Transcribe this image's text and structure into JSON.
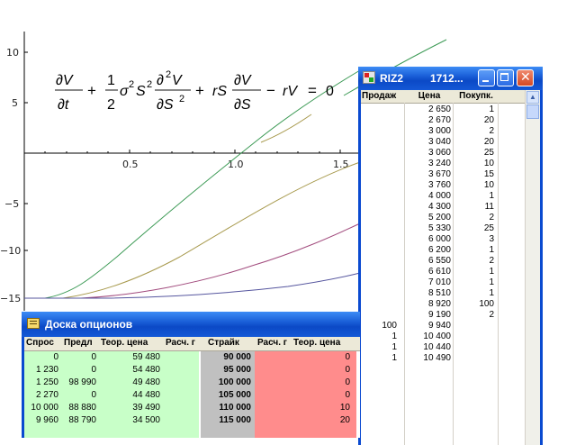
{
  "plot": {
    "equation": "∂V/∂t + ½σ²S² ∂²V/∂S² + rS ∂V/∂S − rV = 0",
    "x_ticks": [
      "0.5",
      "1.0",
      "1.5"
    ],
    "y_ticks": [
      "10",
      "5",
      "−5",
      "−10",
      "−15"
    ],
    "colors": {
      "green": "#3c9a55",
      "olive": "#a89a4e",
      "purple": "#a24c7e",
      "blue": "#55559e"
    }
  },
  "riz_window": {
    "icon": "window-app-icon",
    "title": "RIZ2",
    "title_extra": "1712...",
    "columns": [
      "Продаж",
      "Цена",
      "Покупк."
    ],
    "rows": [
      {
        "sell": "",
        "price": "2 650",
        "buy": "1"
      },
      {
        "sell": "",
        "price": "2 670",
        "buy": "20"
      },
      {
        "sell": "",
        "price": "3 000",
        "buy": "2"
      },
      {
        "sell": "",
        "price": "3 040",
        "buy": "20"
      },
      {
        "sell": "",
        "price": "3 060",
        "buy": "25"
      },
      {
        "sell": "",
        "price": "3 240",
        "buy": "10"
      },
      {
        "sell": "",
        "price": "3 670",
        "buy": "15"
      },
      {
        "sell": "",
        "price": "3 760",
        "buy": "10"
      },
      {
        "sell": "",
        "price": "4 000",
        "buy": "1"
      },
      {
        "sell": "",
        "price": "4 300",
        "buy": "11"
      },
      {
        "sell": "",
        "price": "5 200",
        "buy": "2"
      },
      {
        "sell": "",
        "price": "5 330",
        "buy": "25"
      },
      {
        "sell": "",
        "price": "6 000",
        "buy": "3"
      },
      {
        "sell": "",
        "price": "6 200",
        "buy": "1"
      },
      {
        "sell": "",
        "price": "6 550",
        "buy": "2"
      },
      {
        "sell": "",
        "price": "6 610",
        "buy": "1"
      },
      {
        "sell": "",
        "price": "7 010",
        "buy": "1"
      },
      {
        "sell": "",
        "price": "8 510",
        "buy": "1"
      },
      {
        "sell": "",
        "price": "8 920",
        "buy": "100"
      },
      {
        "sell": "",
        "price": "9 190",
        "buy": "2"
      },
      {
        "sell": "100",
        "price": "9 940",
        "buy": ""
      },
      {
        "sell": "1",
        "price": "10 400",
        "buy": ""
      },
      {
        "sell": "1",
        "price": "10 440",
        "buy": ""
      },
      {
        "sell": "1",
        "price": "10 490",
        "buy": ""
      }
    ]
  },
  "board_window": {
    "title": "Доска опционов",
    "columns": [
      "Спрос",
      "Предл",
      "Теор. цена",
      "Расч. г",
      "Страйк",
      "Расч. г",
      "Теор. цена"
    ],
    "rows": [
      {
        "bid": "0",
        "ask": "0",
        "theo": "59 480",
        "strike": "90 000",
        "theo2": "0"
      },
      {
        "bid": "1 230",
        "ask": "0",
        "theo": "54 480",
        "strike": "95 000",
        "theo2": "0"
      },
      {
        "bid": "1 250",
        "ask": "98 990",
        "theo": "49 480",
        "strike": "100 000",
        "theo2": "0"
      },
      {
        "bid": "2 270",
        "ask": "0",
        "theo": "44 480",
        "strike": "105 000",
        "theo2": "0"
      },
      {
        "bid": "10 000",
        "ask": "88 880",
        "theo": "39 490",
        "strike": "110 000",
        "theo2": "10"
      },
      {
        "bid": "9 960",
        "ask": "88 790",
        "theo": "34 500",
        "strike": "115 000",
        "theo2": "20"
      }
    ]
  }
}
